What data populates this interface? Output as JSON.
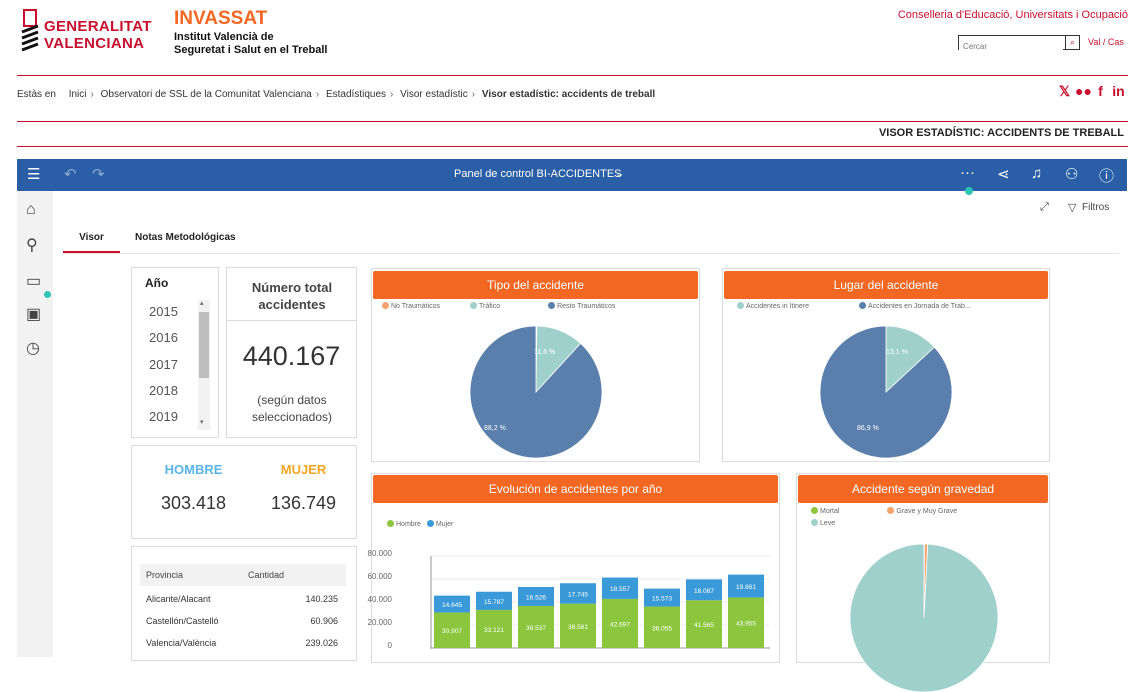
{
  "header": {
    "gva_line1": "GENERALITAT",
    "gva_line2": "VALENCIANA",
    "invassat": "INVASSAT",
    "institute_line1": "Institut Valencià de",
    "institute_line2": "Seguretat i Salut en el Treball",
    "conselleria": "Conselleria d'Educació, Universitats i Ocupació",
    "search_placeholder": "Cercar",
    "lang": "Val / Cas"
  },
  "breadcrumb": {
    "prefix": "Estàs en",
    "items": [
      "Inici",
      "Observatori de SSL de la Comunitat Valenciana",
      "Estadístiques",
      "Visor estadístic"
    ],
    "current": "Visor estadístic: accidents de treball"
  },
  "page_title": "VISOR ESTADÍSTIC: ACCIDENTS DE TREBALL",
  "toolbar": {
    "dashboard_title": "Panel de control BI-ACCIDENTES",
    "filters_label": "Filtros"
  },
  "tabs": [
    {
      "label": "Visor",
      "active": true
    },
    {
      "label": "Notas Metodológicas",
      "active": false
    }
  ],
  "year_filter": {
    "label": "Año",
    "years": [
      "2015",
      "2016",
      "2017",
      "2018",
      "2019"
    ]
  },
  "total": {
    "title": "Número total accidentes",
    "value": "440.167",
    "note": "(según datos seleccionados)"
  },
  "gender": {
    "male_label": "HOMBRE",
    "female_label": "MUJER",
    "male_value": "303.418",
    "female_value": "136.749"
  },
  "province_table": {
    "headers": [
      "Provincia",
      "Cantidad"
    ],
    "rows": [
      [
        "Alicante/Alacant",
        "140.235"
      ],
      [
        "Castellón/Castelló",
        "60.906"
      ],
      [
        "Valencia/València",
        "239.026"
      ]
    ]
  },
  "colors": {
    "accent": "#f26722",
    "toolbar": "#2a5fa8",
    "brand_red": "#c8102e",
    "pie_blue": "#5b7fad",
    "pie_teal": "#9fd0cc",
    "male_green": "#8cc63f",
    "female_blue": "#3a9ad9",
    "orange_light": "#f4a26b"
  },
  "icons": [
    "menu-icon",
    "undo-icon",
    "redo-icon",
    "chevron-down-icon",
    "more-icon",
    "share-icon",
    "bell-icon",
    "user-icon",
    "help-icon",
    "home-icon",
    "search-icon",
    "folder-icon",
    "person-folder-icon",
    "clock-icon",
    "expand-icon",
    "filter-icon",
    "x-icon",
    "flickr-icon",
    "facebook-icon",
    "linkedin-icon"
  ],
  "chart_data": [
    {
      "type": "pie",
      "title": "Tipo del accidente",
      "legend": [
        "No Traumáticos",
        "Tráfico",
        "Resto Traumáticos"
      ],
      "slices": [
        {
          "name": "No Traumáticos",
          "value": 0.2,
          "color": "#f4a26b"
        },
        {
          "name": "Tráfico",
          "value": 11.6,
          "color": "#9fd0cc"
        },
        {
          "name": "Resto Traumáticos",
          "value": 88.2,
          "color": "#5b7fad"
        }
      ],
      "labels": [
        "11,6 %",
        "88,2 %"
      ]
    },
    {
      "type": "pie",
      "title": "Lugar del accidente",
      "legend": [
        "Accidentes in Itinere",
        "Accidentes en Jornada de Trab..."
      ],
      "slices": [
        {
          "name": "Accidentes in Itinere",
          "value": 13.1,
          "color": "#9fd0cc"
        },
        {
          "name": "Accidentes en Jornada de Trab...",
          "value": 86.9,
          "color": "#5b7fad"
        }
      ],
      "labels": [
        "13,1 %",
        "86,9 %"
      ]
    },
    {
      "type": "bar",
      "title": "Evolución de accidentes por año",
      "legend": [
        "Hombre",
        "Mujer"
      ],
      "y_ticks": [
        "80.000",
        "60.000",
        "40.000",
        "20.000",
        "0"
      ],
      "ylim": [
        0,
        80000
      ],
      "series": [
        {
          "name": "Hombre",
          "color": "#8cc63f",
          "values": [
            30907,
            33121,
            36537,
            38581,
            42697,
            36055,
            41565,
            43955
          ],
          "labels": [
            "30.907",
            "33.121",
            "36.537",
            "38.581",
            "42.697",
            "36.055",
            "41.565",
            "43.955"
          ]
        },
        {
          "name": "Mujer",
          "color": "#3a9ad9",
          "values": [
            14645,
            15787,
            16526,
            17745,
            18557,
            15573,
            18087,
            19861
          ],
          "labels": [
            "14.645",
            "15.787",
            "16.526",
            "17.745",
            "18.557",
            "15.573",
            "18.087",
            "19.861"
          ]
        }
      ]
    },
    {
      "type": "pie",
      "title": "Accidente según gravedad",
      "legend": [
        "Mortal",
        "Grave y Muy Grave",
        "Leve"
      ],
      "slices": [
        {
          "name": "Mortal",
          "value": 0.1,
          "color": "#8cc63f"
        },
        {
          "name": "Grave y Muy Grave",
          "value": 0.7,
          "color": "#f4a26b"
        },
        {
          "name": "Leve",
          "value": 99.2,
          "color": "#9fd0cc"
        }
      ]
    }
  ]
}
